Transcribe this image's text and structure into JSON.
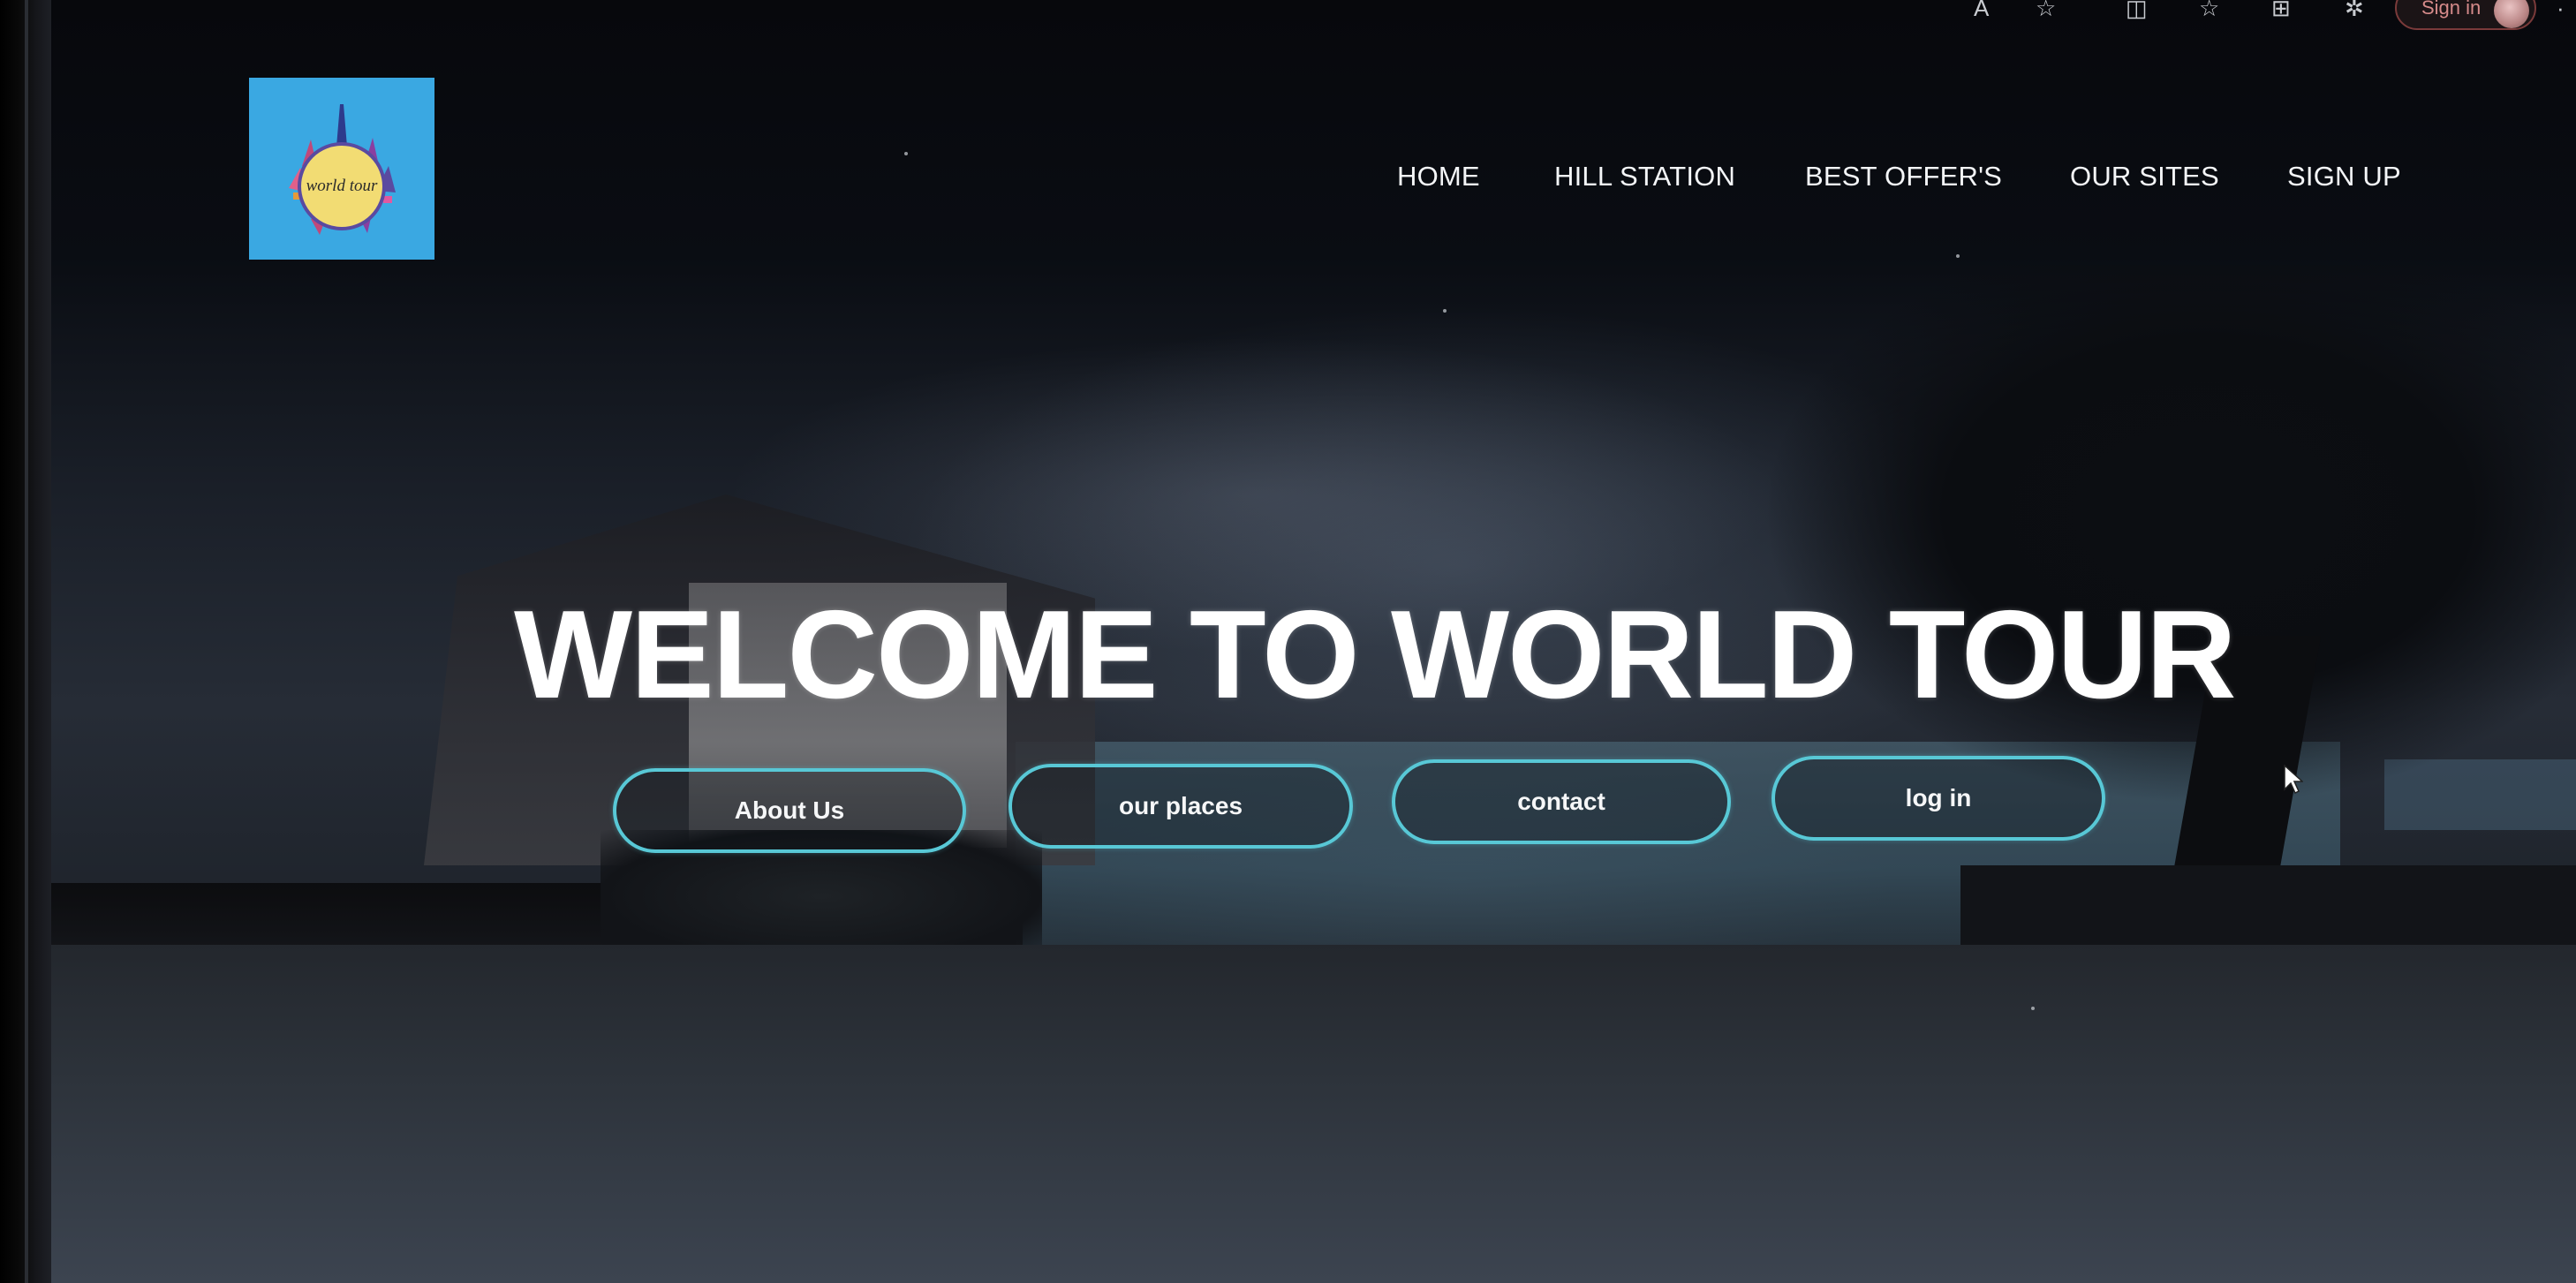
{
  "browser": {
    "icons": [
      "read-aloud-icon",
      "favorite-star-icon",
      "split-screen-icon",
      "favorites-list-icon",
      "collections-icon",
      "extensions-icon",
      "more-icon"
    ],
    "signin_label": "Sign in"
  },
  "logo": {
    "text": "world tour"
  },
  "nav": {
    "items": [
      "HOME",
      "HILL STATION",
      "BEST OFFER'S",
      "OUR SITES",
      "SIGN UP"
    ]
  },
  "hero": {
    "headline": "WELCOME TO WORLD TOUR",
    "buttons": [
      "About Us",
      "our places",
      "contact",
      "log in"
    ]
  },
  "colors": {
    "button_border": "#58c8d6",
    "logo_bg": "#3aa8e2",
    "logo_circle": "#f2dc73",
    "signin_text": "#d58a8a"
  }
}
